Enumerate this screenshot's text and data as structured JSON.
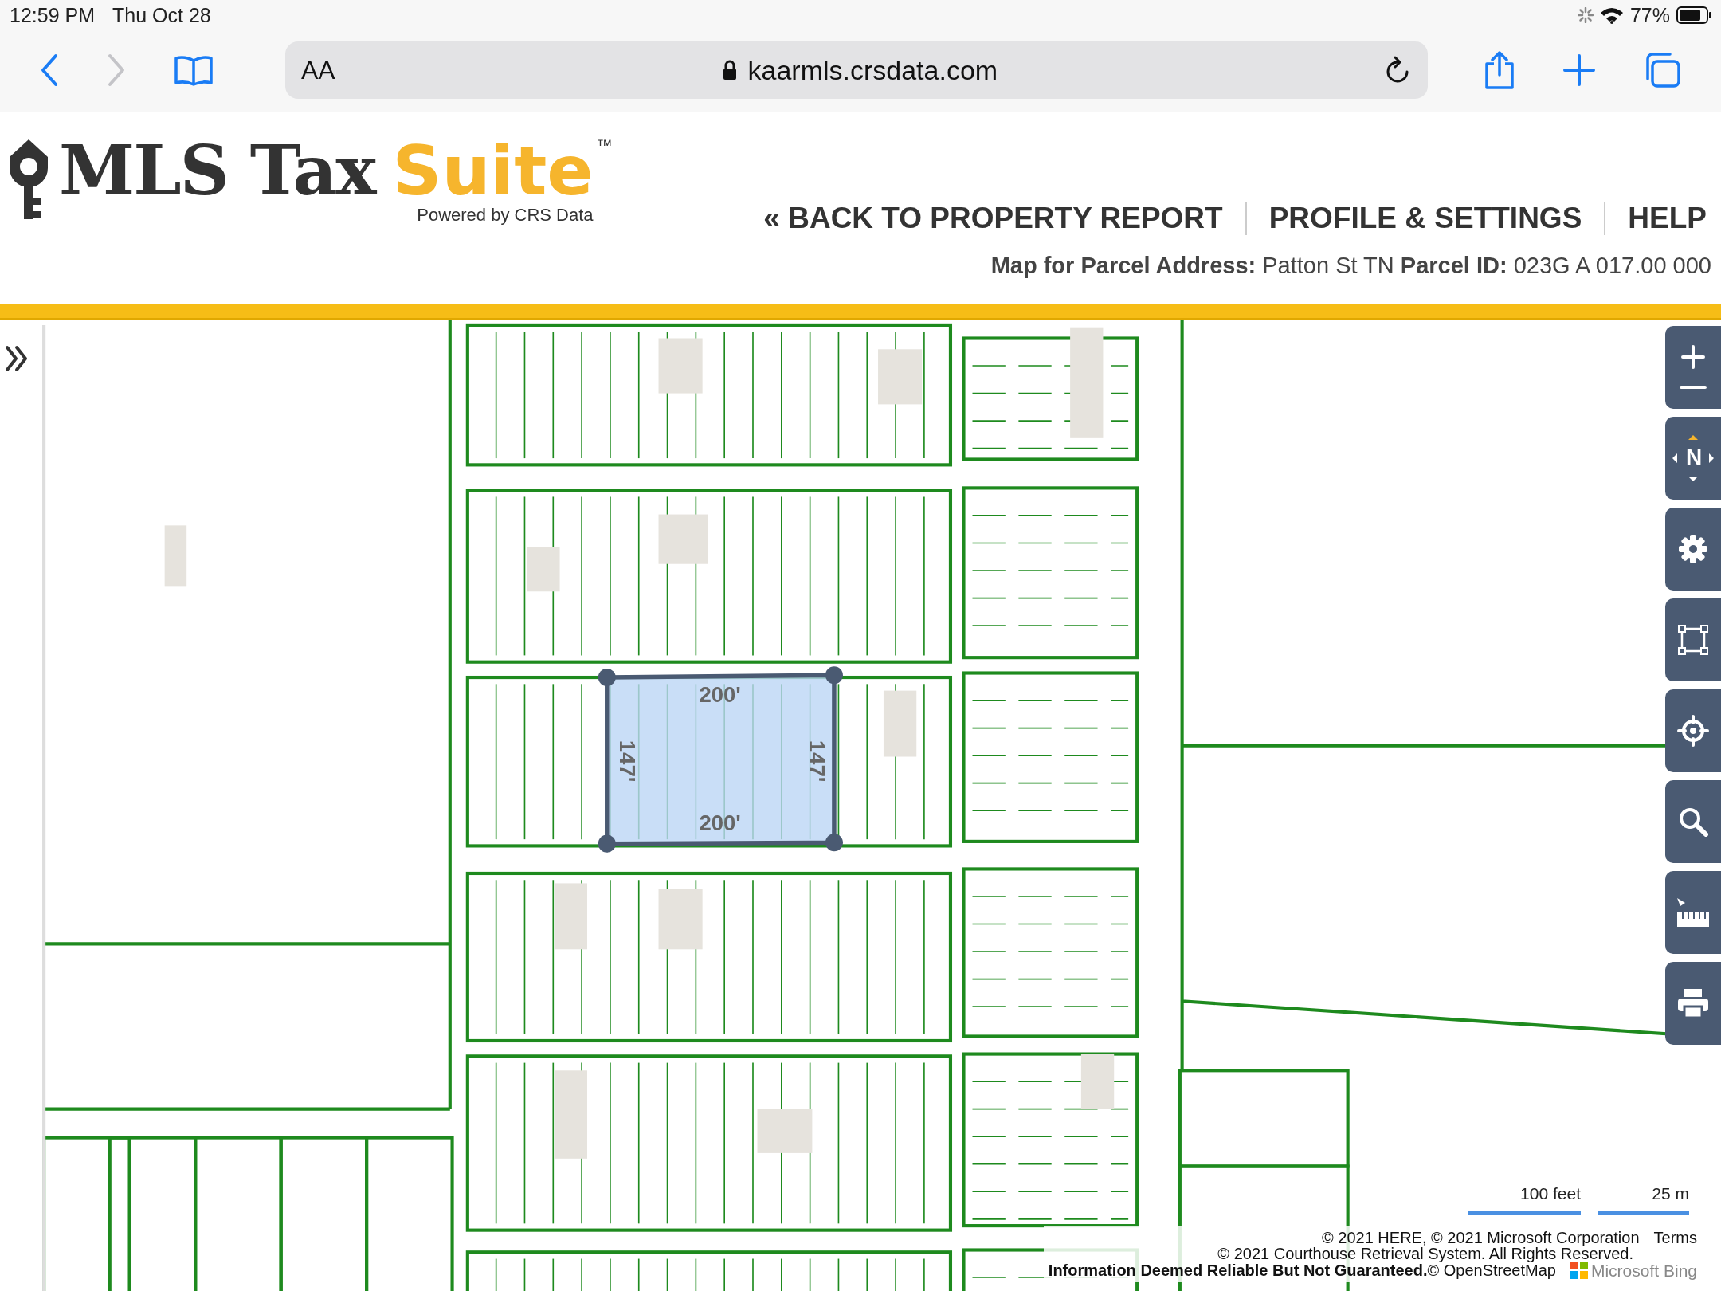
{
  "status_bar": {
    "time": "12:59 PM",
    "date": "Thu Oct 28",
    "battery": "77%"
  },
  "browser_toolbar": {
    "forward_disabled": true,
    "text_size_label": "AA",
    "url": "kaarmls.crsdata.com"
  },
  "header": {
    "logo": {
      "word_1": "MLS Tax",
      "word_2": "Suite",
      "trademark": "™",
      "tagline": "Powered by CRS Data"
    },
    "nav": [
      {
        "label": "« BACK TO PROPERTY REPORT"
      },
      {
        "label": "PROFILE & SETTINGS"
      },
      {
        "label": "HELP"
      }
    ],
    "parcel_info": "**Map for Parcel Address:** Patton St TN **Parcel ID:** 023G A 017.00 000"
  },
  "map": {
    "selection": {
      "labels": [
        {
          "text": "200'"
        },
        {
          "text": "200'"
        },
        {
          "text": "147'"
        },
        {
          "text": "147'"
        }
      ]
    },
    "controls": [
      {
        "kind": "zoom"
      },
      {
        "kind": "compass",
        "label": "N"
      },
      {
        "kind": "settings"
      },
      {
        "kind": "select"
      },
      {
        "kind": "locate"
      },
      {
        "kind": "search"
      },
      {
        "kind": "measure"
      },
      {
        "kind": "print"
      }
    ],
    "scale": [
      "100 feet",
      "25 m"
    ],
    "attribution": {
      "line_1": "© 2021 HERE, © 2021 Microsoft Corporation",
      "terms": "Terms",
      "line_2": "© 2021 Courthouse Retrieval System. All Rights Reserved.",
      "line_3": "**Information Deemed Reliable But Not Guaranteed.**© OpenStreetMap",
      "provider": "Microsoft Bing"
    }
  }
}
